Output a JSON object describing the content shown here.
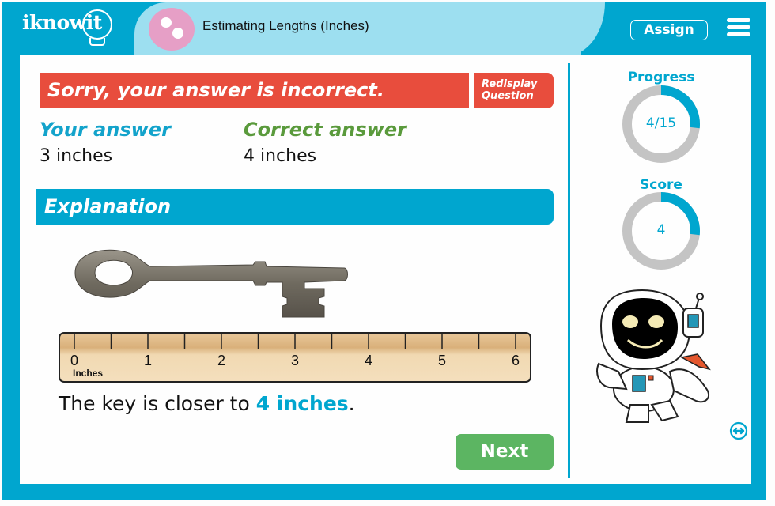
{
  "header": {
    "logo_text": "iknowit",
    "topic_title": "Estimating Lengths (Inches)",
    "assign_label": "Assign",
    "menu_icon": "hamburger-menu-icon"
  },
  "feedback": {
    "message": "Sorry, your answer is incorrect.",
    "redisplay_line1": "Redisplay",
    "redisplay_line2": "Question",
    "your_answer_label": "Your answer",
    "your_answer_value": "3 inches",
    "correct_answer_label": "Correct answer",
    "correct_answer_value": "4 inches"
  },
  "explanation": {
    "title": "Explanation",
    "ruler_unit": "Inches",
    "ruler_ticks": [
      "0",
      "1",
      "2",
      "3",
      "4",
      "5",
      "6"
    ],
    "sentence_prefix": "The key is closer to ",
    "sentence_highlight": "4 inches",
    "sentence_suffix": "."
  },
  "next_label": "Next",
  "sidebar": {
    "progress_label": "Progress",
    "progress_value": "4/15",
    "progress_fraction": 0.2667,
    "score_label": "Score",
    "score_value": "4",
    "score_fraction": 0.2667
  },
  "colors": {
    "brand_teal": "#00a6cf",
    "light_teal": "#9ddff0",
    "error_red": "#e84d3d",
    "correct_green": "#5a9a3c",
    "next_green": "#5cb562",
    "ring_gray": "#c4c4c4"
  }
}
